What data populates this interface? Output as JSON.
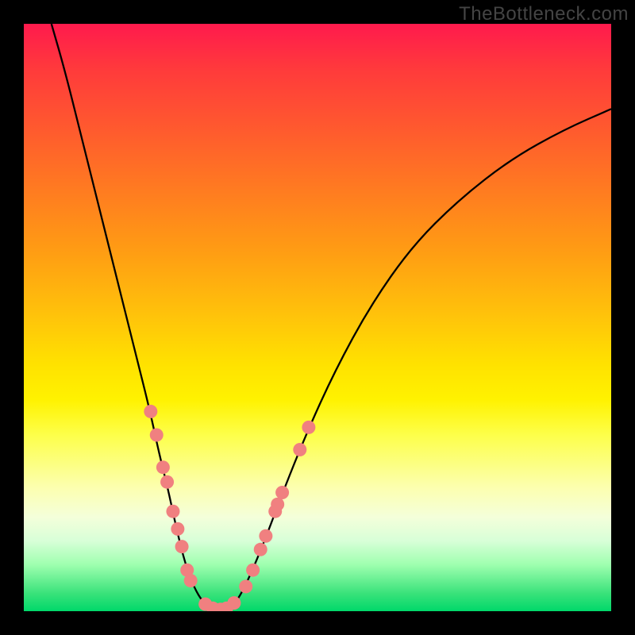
{
  "watermark": "TheBottleneck.com",
  "chart_data": {
    "type": "line",
    "title": "",
    "xlabel": "",
    "ylabel": "",
    "xlim": [
      0,
      100
    ],
    "ylim": [
      0,
      100
    ],
    "curve_left": [
      {
        "x": 4.7,
        "y": 100
      },
      {
        "x": 7.0,
        "y": 92
      },
      {
        "x": 10.0,
        "y": 80
      },
      {
        "x": 13.0,
        "y": 68
      },
      {
        "x": 16.0,
        "y": 56
      },
      {
        "x": 19.0,
        "y": 44
      },
      {
        "x": 21.5,
        "y": 34
      },
      {
        "x": 23.0,
        "y": 27
      },
      {
        "x": 24.5,
        "y": 21
      },
      {
        "x": 26.0,
        "y": 14
      },
      {
        "x": 27.5,
        "y": 8
      },
      {
        "x": 29.0,
        "y": 4
      },
      {
        "x": 30.5,
        "y": 1.5
      },
      {
        "x": 32.0,
        "y": 0.4
      },
      {
        "x": 33.3,
        "y": 0
      }
    ],
    "curve_right": [
      {
        "x": 33.3,
        "y": 0
      },
      {
        "x": 35.0,
        "y": 0.5
      },
      {
        "x": 36.5,
        "y": 2
      },
      {
        "x": 38.5,
        "y": 6
      },
      {
        "x": 41.0,
        "y": 12
      },
      {
        "x": 44.0,
        "y": 20
      },
      {
        "x": 48.0,
        "y": 30
      },
      {
        "x": 53.0,
        "y": 41
      },
      {
        "x": 59.0,
        "y": 52
      },
      {
        "x": 66.0,
        "y": 62
      },
      {
        "x": 74.0,
        "y": 70
      },
      {
        "x": 83.0,
        "y": 77
      },
      {
        "x": 92.0,
        "y": 82
      },
      {
        "x": 100.0,
        "y": 85.5
      }
    ],
    "scatter": [
      {
        "x": 21.6,
        "y": 34.0
      },
      {
        "x": 22.6,
        "y": 30.0
      },
      {
        "x": 23.7,
        "y": 24.5
      },
      {
        "x": 24.4,
        "y": 22.0
      },
      {
        "x": 25.4,
        "y": 17.0
      },
      {
        "x": 26.2,
        "y": 14.0
      },
      {
        "x": 26.9,
        "y": 11.0
      },
      {
        "x": 27.8,
        "y": 7.0
      },
      {
        "x": 28.4,
        "y": 5.2
      },
      {
        "x": 30.9,
        "y": 1.2
      },
      {
        "x": 32.2,
        "y": 0.5
      },
      {
        "x": 33.5,
        "y": 0.3
      },
      {
        "x": 34.5,
        "y": 0.5
      },
      {
        "x": 35.8,
        "y": 1.4
      },
      {
        "x": 37.8,
        "y": 4.2
      },
      {
        "x": 39.0,
        "y": 7.0
      },
      {
        "x": 40.3,
        "y": 10.5
      },
      {
        "x": 41.2,
        "y": 12.8
      },
      {
        "x": 42.8,
        "y": 17.0
      },
      {
        "x": 43.2,
        "y": 18.2
      },
      {
        "x": 44.0,
        "y": 20.2
      },
      {
        "x": 47.0,
        "y": 27.5
      },
      {
        "x": 48.5,
        "y": 31.3
      }
    ],
    "scatter_radius": 8.5
  },
  "colors": {
    "curve": "#000000",
    "scatter": "#f08080"
  }
}
